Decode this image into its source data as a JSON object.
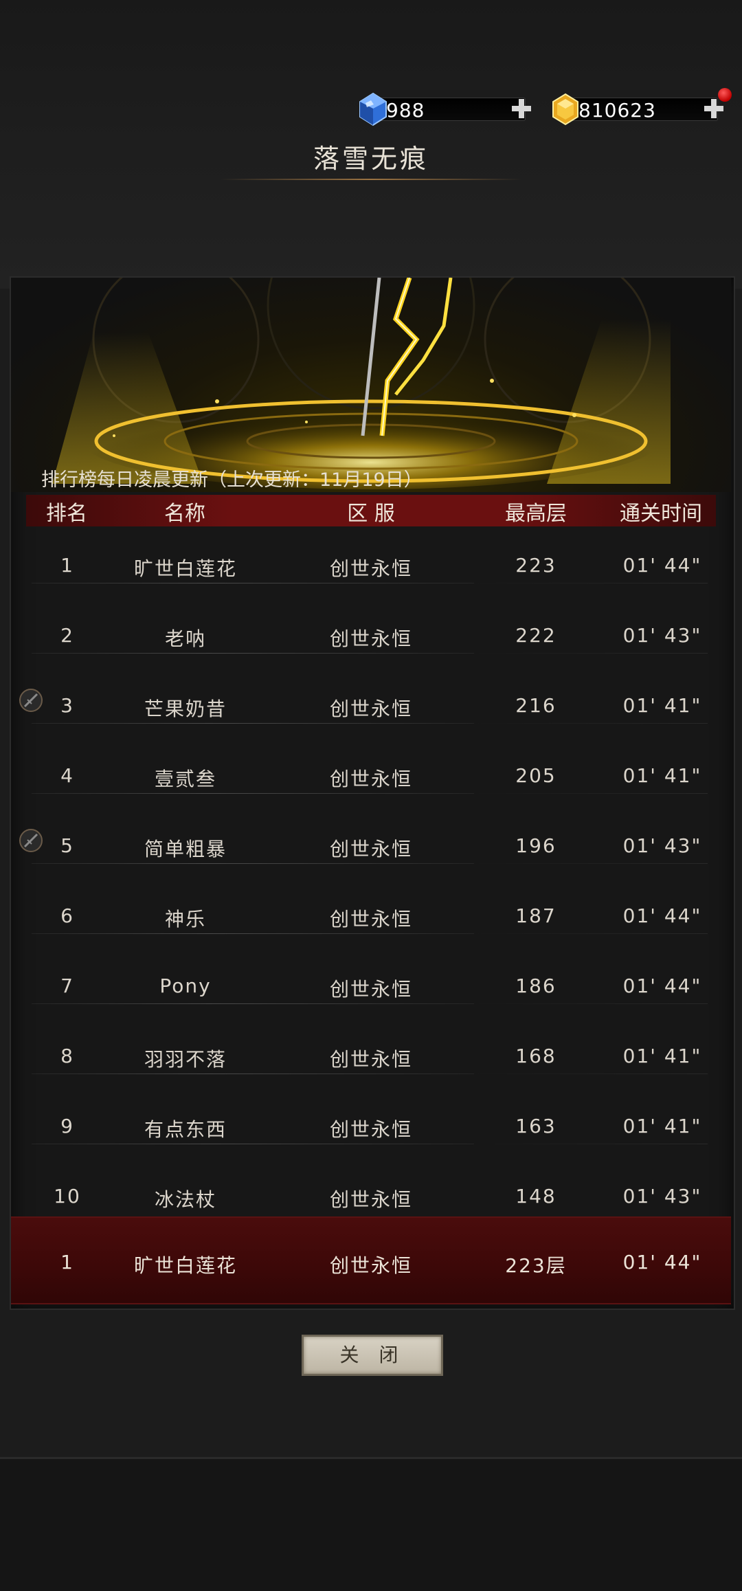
{
  "currency": {
    "gems": "988",
    "gold": "810623"
  },
  "player": {
    "name": "落雪无痕"
  },
  "leaderboard": {
    "update_note": "排行榜每日凌晨更新（上次更新：11月19日）",
    "headers": {
      "rank": "排名",
      "name": "名称",
      "server": "区 服",
      "highest_floor": "最高层",
      "clear_time": "通关时间"
    },
    "rows": [
      {
        "rank": "1",
        "name": "旷世白莲花",
        "server": "创世永恒",
        "floor": "223",
        "time": "01' 44\"",
        "badge": false
      },
      {
        "rank": "2",
        "name": "老呐",
        "server": "创世永恒",
        "floor": "222",
        "time": "01' 43\"",
        "badge": false
      },
      {
        "rank": "3",
        "name": "芒果奶昔",
        "server": "创世永恒",
        "floor": "216",
        "time": "01' 41\"",
        "badge": true
      },
      {
        "rank": "4",
        "name": "壹贰叁",
        "server": "创世永恒",
        "floor": "205",
        "time": "01' 41\"",
        "badge": false
      },
      {
        "rank": "5",
        "name": "简单粗暴",
        "server": "创世永恒",
        "floor": "196",
        "time": "01' 43\"",
        "badge": true
      },
      {
        "rank": "6",
        "name": "神乐",
        "server": "创世永恒",
        "floor": "187",
        "time": "01' 44\"",
        "badge": false
      },
      {
        "rank": "7",
        "name": "Pony",
        "server": "创世永恒",
        "floor": "186",
        "time": "01' 44\"",
        "badge": false
      },
      {
        "rank": "8",
        "name": "羽羽不落",
        "server": "创世永恒",
        "floor": "168",
        "time": "01' 41\"",
        "badge": false
      },
      {
        "rank": "9",
        "name": "有点东西",
        "server": "创世永恒",
        "floor": "163",
        "time": "01' 41\"",
        "badge": false
      },
      {
        "rank": "10",
        "name": "冰法杖",
        "server": "创世永恒",
        "floor": "148",
        "time": "01' 43\"",
        "badge": false
      }
    ],
    "self": {
      "rank": "1",
      "name": "旷世白莲花",
      "server": "创世永恒",
      "floor": "223层",
      "time": "01' 44\""
    }
  },
  "buttons": {
    "close": "关 闭"
  },
  "icons": {
    "gem": "blue-gem-icon",
    "gold": "gold-coin-icon",
    "plus": "plus-icon",
    "badge": "rank-badge-icon"
  },
  "colors": {
    "header_red": "#6a1010",
    "self_row_red": "#4a0c0c",
    "accent_gold": "#f0c030",
    "gem_blue": "#3a7ae8"
  }
}
